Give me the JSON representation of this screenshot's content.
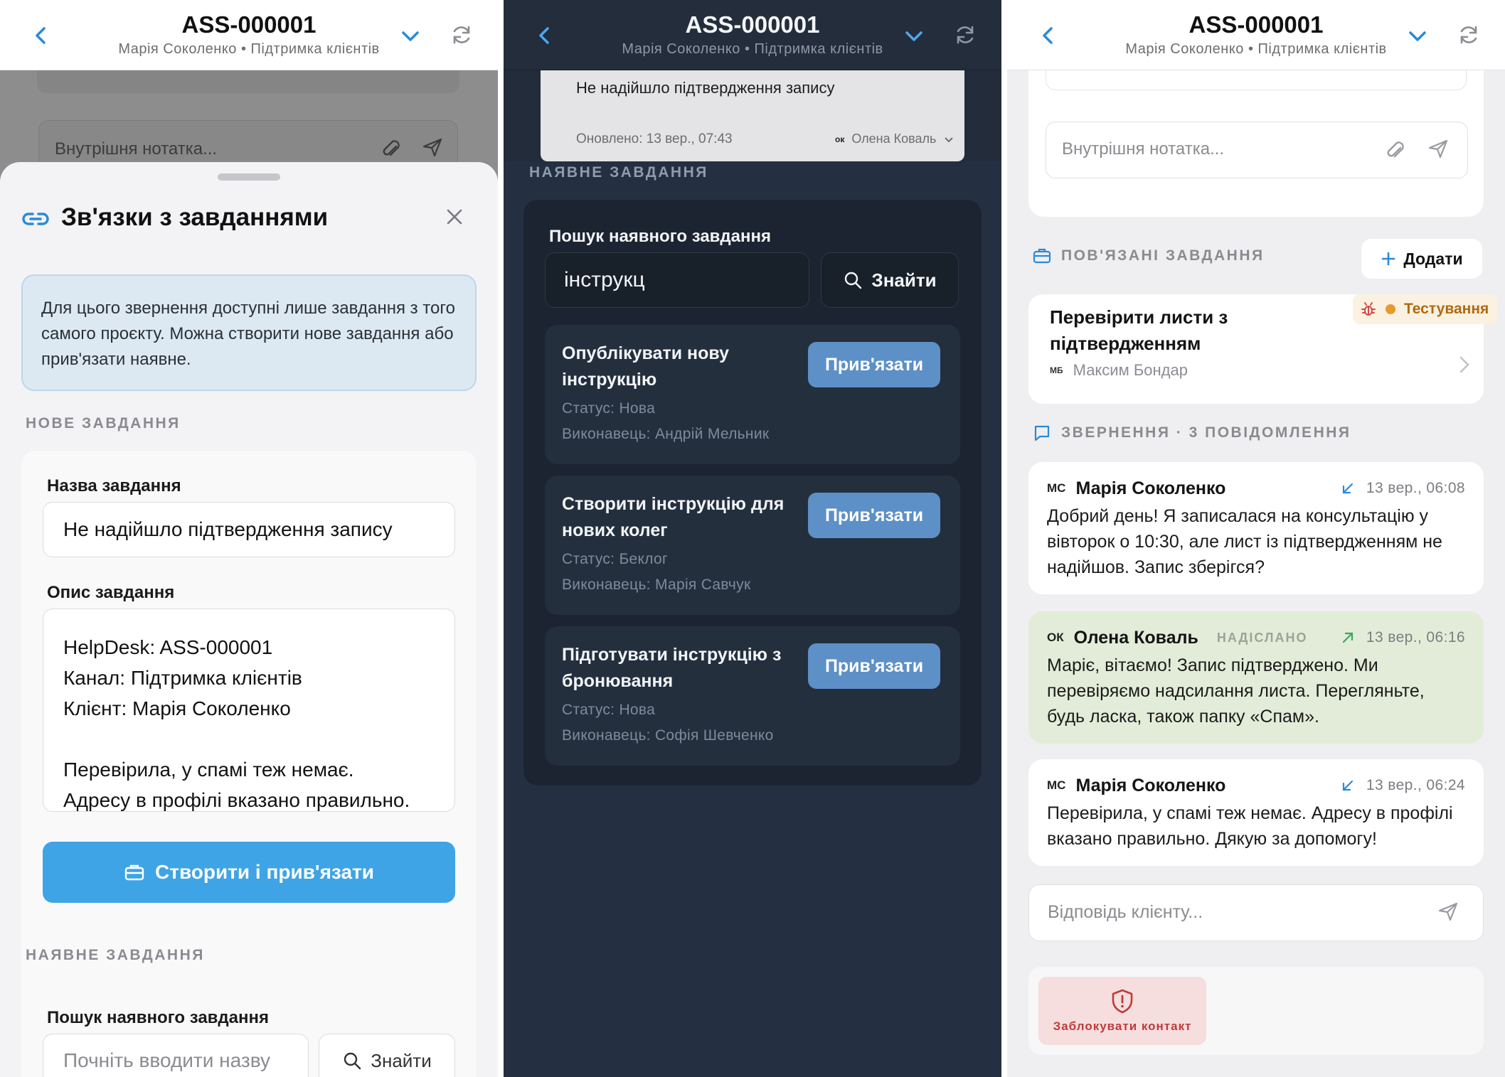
{
  "header": {
    "title": "ASS-000001",
    "subtitle": "Марія Соколенко • Підтримка клієнтів"
  },
  "panel1": {
    "background_note_placeholder": "Внутрішня нотатка...",
    "sheet_title": "Зв'язки з завданнями",
    "info_text": "Для цього звернення доступні лише завдання з того самого проєкту. Можна створити нове завдання або прив'язати наявне.",
    "new_task_section": "НОВЕ ЗАВДАННЯ",
    "task_name_label": "Назва завдання",
    "task_name_value": "Не надійшло підтвердження запису",
    "task_desc_label": "Опис завдання",
    "task_desc_value": "HelpDesk: ASS-000001\nКанал: Підтримка клієнтів\nКлієнт: Марія Соколенко\n\nПеревірила, у спамі теж немає.\nАдресу в профілі вказано правильно.",
    "create_button": "Створити і прив'язати",
    "existing_section": "НАЯВНЕ ЗАВДАННЯ",
    "search_label": "Пошук наявного завдання",
    "search_placeholder": "Почніть вводити назву",
    "search_button": "Знайти"
  },
  "panel2": {
    "top_card_title": "Не надійшло підтвердження запису",
    "top_card_updated": "Оновлено: 13 вер., 07:43",
    "top_card_initials": "ок",
    "top_card_person": "Олена Коваль",
    "existing_section": "НАЯВНЕ ЗАВДАННЯ",
    "search_label": "Пошук наявного завдання",
    "search_value": "інструкц",
    "search_button": "Знайти",
    "results": [
      {
        "title": "Опублікувати нову інструкцію",
        "status": "Статус: Нова",
        "assignee": "Виконавець: Андрій Мельник",
        "button": "Прив'язати"
      },
      {
        "title": "Створити інструкцію для нових колег",
        "status": "Статус: Беклог",
        "assignee": "Виконавець: Марія Савчук",
        "button": "Прив'язати"
      },
      {
        "title": "Підготувати інструкцію з бронювання",
        "status": "Статус: Нова",
        "assignee": "Виконавець: Софія Шевченко",
        "button": "Прив'язати"
      }
    ]
  },
  "panel3": {
    "note_placeholder": "Внутрішня нотатка...",
    "linked_section": "ПОВ'ЯЗАНІ ЗАВДАННЯ",
    "add_button": "Додати",
    "linked_task": {
      "title": "Перевірити листи з підтвердженням",
      "status": "Тестування",
      "assignee_initials": "МБ",
      "assignee": "Максим Бондар"
    },
    "messages_section": "ЗВЕРНЕННЯ · 3 ПОВІДОМЛЕННЯ",
    "messages": [
      {
        "initials": "МС",
        "name": "Марія Соколенко",
        "time": "13 вер., 06:08",
        "body": "Добрий день! Я записалася на консультацію у вівторок о 10:30, але лист із підтвердженням не надійшов. Запис зберігся?"
      },
      {
        "initials": "ОК",
        "name": "Олена Коваль",
        "sent_label": "НАДІСЛАНО",
        "time": "13 вер., 06:16",
        "body": "Маріє, вітаємо! Запис підтверджено. Ми перевіряємо надсилання листа. Перегляньте, будь ласка, також папку «Спам»."
      },
      {
        "initials": "МС",
        "name": "Марія Соколенко",
        "time": "13 вер., 06:24",
        "body": "Перевірила, у спамі теж немає. Адресу в профілі вказано правильно. Дякую за допомогу!"
      }
    ],
    "reply_placeholder": "Відповідь клієнту...",
    "block_button": "Заблокувати контакт"
  },
  "colors": {
    "accent": "#3ea4e5",
    "bind_button": "#5d90c6",
    "status_testing": "#e69a2a",
    "outgoing_message": "#e3ecd9",
    "danger": "#c03a3a"
  },
  "icons": [
    "back-chevron-icon",
    "chevron-down-icon",
    "refresh-icon",
    "link-icon",
    "close-icon",
    "paperclip-icon",
    "send-icon",
    "search-icon",
    "briefcase-icon",
    "plus-icon",
    "bug-icon",
    "chevron-right-icon",
    "chat-icon",
    "incoming-arrow-icon",
    "outgoing-arrow-icon",
    "shield-alert-icon"
  ]
}
